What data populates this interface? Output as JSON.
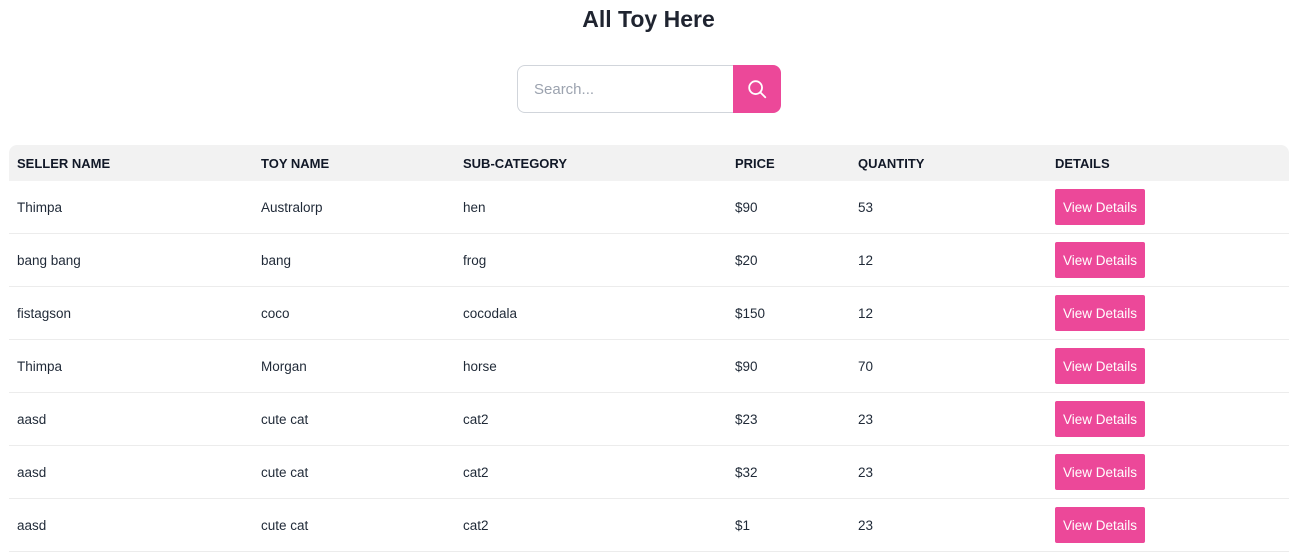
{
  "header": {
    "title": "All Toy Here"
  },
  "search": {
    "placeholder": "Search...",
    "value": "",
    "button_icon": "search-icon",
    "button_color": "#ec4899"
  },
  "table": {
    "headers": [
      "SELLER NAME",
      "TOY NAME",
      "SUB-CATEGORY",
      "PRICE",
      "QUANTITY",
      "DETAILS"
    ],
    "rows": [
      {
        "seller": "Thimpa",
        "toy": "Australorp",
        "sub_category": "hen",
        "price": "$90",
        "quantity": "53",
        "action": "View Details"
      },
      {
        "seller": "bang bang",
        "toy": "bang",
        "sub_category": "frog",
        "price": "$20",
        "quantity": "12",
        "action": "View Details"
      },
      {
        "seller": "fistagson",
        "toy": "coco",
        "sub_category": "cocodala",
        "price": "$150",
        "quantity": "12",
        "action": "View Details"
      },
      {
        "seller": "Thimpa",
        "toy": "Morgan",
        "sub_category": "horse",
        "price": "$90",
        "quantity": "70",
        "action": "View Details"
      },
      {
        "seller": "aasd",
        "toy": "cute cat",
        "sub_category": "cat2",
        "price": "$23",
        "quantity": "23",
        "action": "View Details"
      },
      {
        "seller": "aasd",
        "toy": "cute cat",
        "sub_category": "cat2",
        "price": "$32",
        "quantity": "23",
        "action": "View Details"
      },
      {
        "seller": "aasd",
        "toy": "cute cat",
        "sub_category": "cat2",
        "price": "$1",
        "quantity": "23",
        "action": "View Details"
      }
    ]
  },
  "colors": {
    "accent": "#ec4899",
    "header_bg": "#f2f2f2"
  }
}
